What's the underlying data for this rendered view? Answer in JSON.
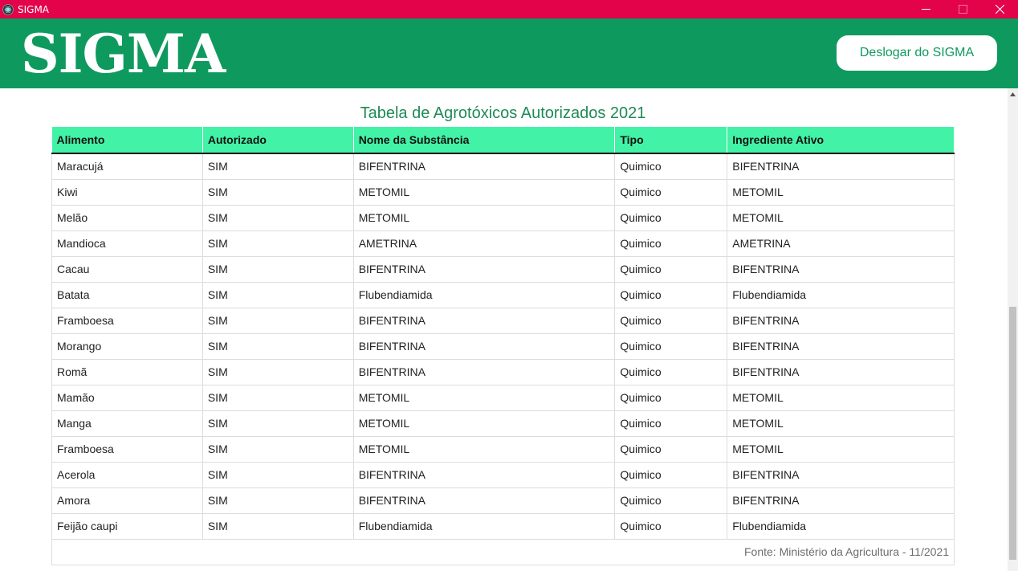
{
  "window": {
    "title": "SIGMA"
  },
  "header": {
    "logo": "SIGMA",
    "logout_label": "Deslogar do SIGMA"
  },
  "table": {
    "title": "Tabela de Agrotóxicos Autorizados 2021",
    "columns": [
      "Alimento",
      "Autorizado",
      "Nome da Substância",
      "Tipo",
      "Ingrediente Ativo"
    ],
    "rows": [
      [
        "Maracujá",
        "SIM",
        "BIFENTRINA",
        "Quimico",
        "BIFENTRINA"
      ],
      [
        "Kiwi",
        "SIM",
        "METOMIL",
        "Quimico",
        "METOMIL"
      ],
      [
        "Melão",
        "SIM",
        "METOMIL",
        "Quimico",
        "METOMIL"
      ],
      [
        "Mandioca",
        "SIM",
        "AMETRINA",
        "Quimico",
        "AMETRINA"
      ],
      [
        "Cacau",
        "SIM",
        "BIFENTRINA",
        "Quimico",
        "BIFENTRINA"
      ],
      [
        "Batata",
        "SIM",
        "Flubendiamida",
        "Quimico",
        "Flubendiamida"
      ],
      [
        "Framboesa",
        "SIM",
        "BIFENTRINA",
        "Quimico",
        "BIFENTRINA"
      ],
      [
        "Morango",
        "SIM",
        "BIFENTRINA",
        "Quimico",
        "BIFENTRINA"
      ],
      [
        "Romã",
        "SIM",
        "BIFENTRINA",
        "Quimico",
        "BIFENTRINA"
      ],
      [
        "Mamão",
        "SIM",
        "METOMIL",
        "Quimico",
        "METOMIL"
      ],
      [
        "Manga",
        "SIM",
        "METOMIL",
        "Quimico",
        "METOMIL"
      ],
      [
        "Framboesa",
        "SIM",
        "METOMIL",
        "Quimico",
        "METOMIL"
      ],
      [
        "Acerola",
        "SIM",
        "BIFENTRINA",
        "Quimico",
        "BIFENTRINA"
      ],
      [
        "Amora",
        "SIM",
        "BIFENTRINA",
        "Quimico",
        "BIFENTRINA"
      ],
      [
        "Feijão caupi",
        "SIM",
        "Flubendiamida",
        "Quimico",
        "Flubendiamida"
      ]
    ],
    "source": "Fonte: Ministério da Agricultura - 11/2021"
  },
  "colors": {
    "titlebar": "#e2034b",
    "header": "#0e9a5e",
    "table_header": "#42f2a6",
    "title_text": "#1d8a55"
  }
}
